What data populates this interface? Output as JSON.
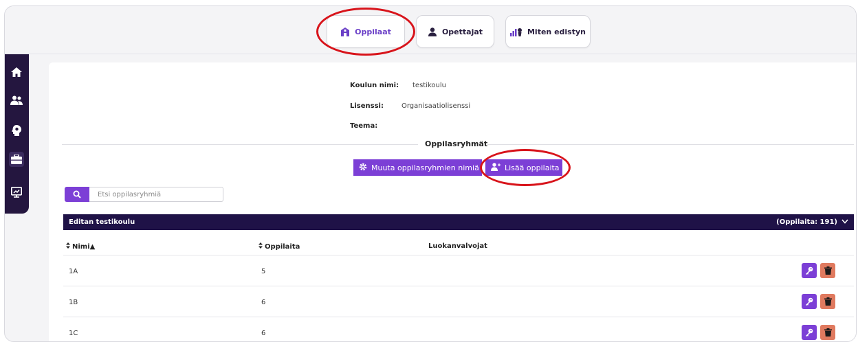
{
  "topnav": {
    "items": [
      {
        "label": "Oppilaat",
        "icon": "school-icon",
        "active": true
      },
      {
        "label": "Opettajat",
        "icon": "teacher-icon",
        "active": false
      },
      {
        "label": "Miten edistyn",
        "icon": "progress-chart-icon",
        "active": false
      }
    ]
  },
  "sidebar": {
    "items": [
      {
        "icon": "home-icon"
      },
      {
        "icon": "users-icon"
      },
      {
        "icon": "brain-icon"
      },
      {
        "icon": "toolbox-icon",
        "active": true
      },
      {
        "icon": "presentation-icon"
      }
    ]
  },
  "school": {
    "name_label": "Koulun nimi:",
    "name_value": "testikoulu",
    "license_label": "Lisenssi:",
    "license_value": "Organisaatiolisenssi",
    "theme_label": "Teema:"
  },
  "groups_section": {
    "title": "Oppilasryhmät",
    "rename_button": "Muuta oppilasryhmien nimiä",
    "add_students_button": "Lisää oppilaita"
  },
  "search": {
    "placeholder": "Etsi oppilasryhmiä"
  },
  "group": {
    "name": "Editan testikoulu",
    "count_label": "(Oppilaita: 191)"
  },
  "table": {
    "columns": [
      "Nimi▲",
      "Oppilaita",
      "Luokanvalvojat"
    ],
    "rows": [
      {
        "name": "1A",
        "students": "5",
        "teachers": ""
      },
      {
        "name": "1B",
        "students": "6",
        "teachers": ""
      },
      {
        "name": "1C",
        "students": "6",
        "teachers": ""
      }
    ]
  },
  "colors": {
    "primary": "#7c3fd6",
    "dark": "#1f1247",
    "sidebar": "#24163f",
    "delete": "#e07a5f",
    "highlight_ring": "#d8141b"
  }
}
